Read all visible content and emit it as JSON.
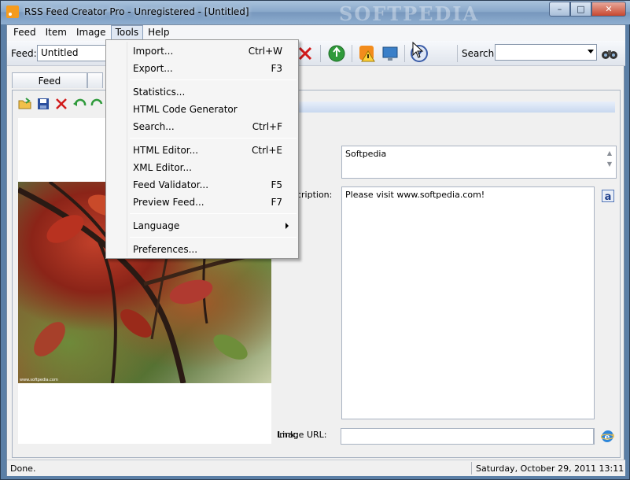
{
  "window": {
    "title": "RSS Feed Creator Pro - Unregistered - [Untitled]",
    "watermark": "SOFTPEDIA",
    "minimize": "–",
    "maximize": "□",
    "close": "✕"
  },
  "menubar": [
    "Feed",
    "Item",
    "Image",
    "Tools",
    "Help"
  ],
  "toolbar": {
    "feed_label": "Feed:",
    "feed_value": "Untitled",
    "search_label": "Search:",
    "search_value": ""
  },
  "tabs": [
    "Feed",
    ""
  ],
  "form": {
    "title_value": "Softpedia",
    "description_label": "Description:",
    "description_value": "Please visit www.softpedia.com!",
    "link_label": "Link:",
    "link_value": "",
    "image_url_label": "Image URL:",
    "image_url_value": ""
  },
  "image_panel": {
    "caption": "www.softpedia.com"
  },
  "tools_menu": [
    {
      "label": "Import...",
      "shortcut": "Ctrl+W"
    },
    {
      "label": "Export...",
      "shortcut": "F3"
    },
    {
      "label": "Statistics...",
      "shortcut": ""
    },
    {
      "label": "HTML Code Generator",
      "shortcut": ""
    },
    {
      "label": "Search...",
      "shortcut": "Ctrl+F"
    },
    {
      "label": "HTML Editor...",
      "shortcut": "Ctrl+E"
    },
    {
      "label": "XML Editor...",
      "shortcut": ""
    },
    {
      "label": "Feed Validator...",
      "shortcut": "F5"
    },
    {
      "label": "Preview Feed...",
      "shortcut": "F7"
    },
    {
      "label": "Language",
      "shortcut": ""
    },
    {
      "label": "Preferences...",
      "shortcut": ""
    }
  ],
  "status": {
    "left": "Done.",
    "right": "Saturday, October 29, 2011 13:11"
  }
}
